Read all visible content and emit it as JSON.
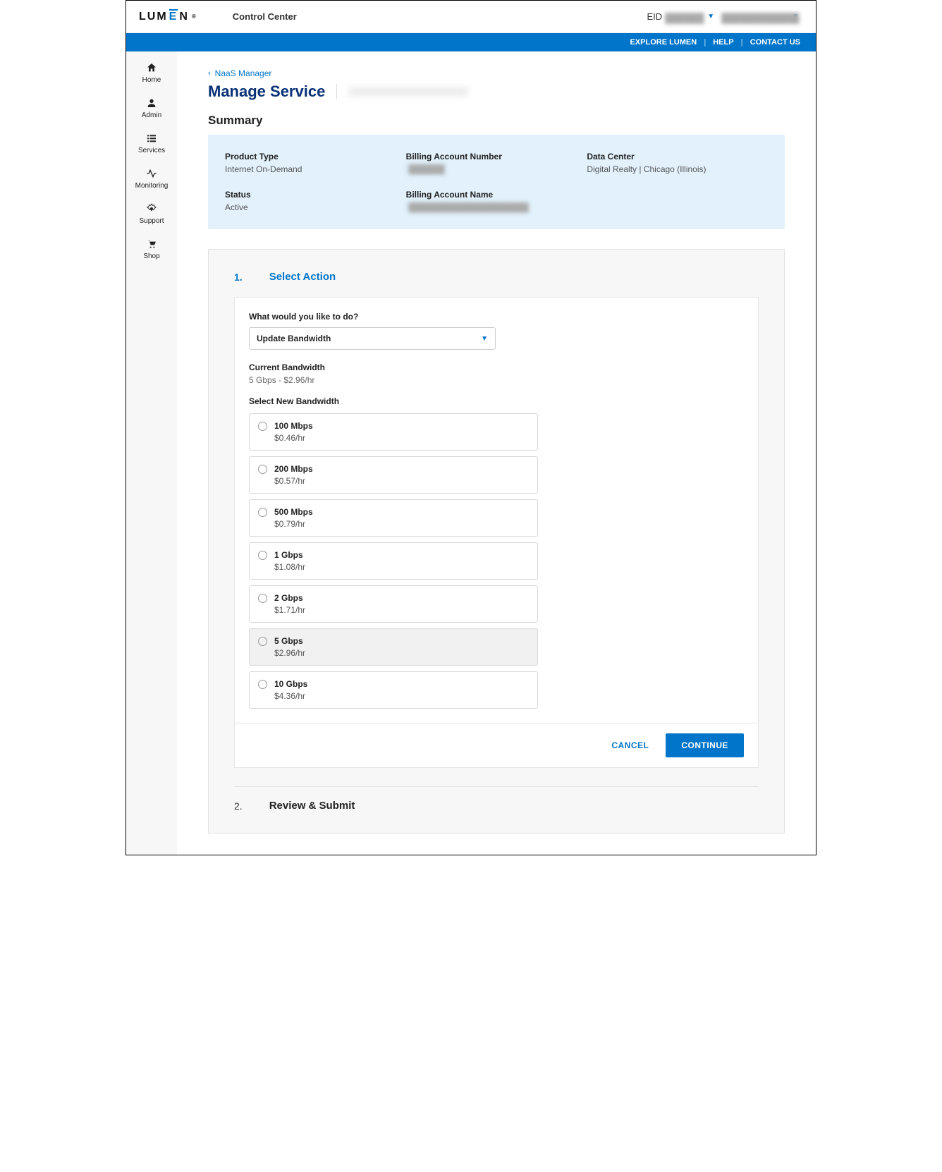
{
  "header": {
    "logo_text": "LUMEN",
    "app_title": "Control Center",
    "eid_label": "EID",
    "eid_value": "██████",
    "account_value": "████████████"
  },
  "bluebar": {
    "explore": "EXPLORE LUMEN",
    "help": "HELP",
    "contact": "CONTACT US"
  },
  "sidebar": {
    "items": [
      {
        "label": "Home",
        "icon": "home-icon"
      },
      {
        "label": "Admin",
        "icon": "user-icon"
      },
      {
        "label": "Services",
        "icon": "list-icon"
      },
      {
        "label": "Monitoring",
        "icon": "activity-icon"
      },
      {
        "label": "Support",
        "icon": "support-icon"
      },
      {
        "label": "Shop",
        "icon": "cart-icon"
      }
    ]
  },
  "breadcrumb": {
    "back_label": "NaaS Manager"
  },
  "page": {
    "title": "Manage Service",
    "section_summary": "Summary"
  },
  "summary": {
    "product_type_label": "Product Type",
    "product_type_value": "Internet On-Demand",
    "billing_number_label": "Billing Account Number",
    "billing_number_value": "██████",
    "data_center_label": "Data Center",
    "data_center_value": "Digital Realty | Chicago (Illinois)",
    "status_label": "Status",
    "status_value": "Active",
    "billing_name_label": "Billing Account Name",
    "billing_name_value": "████████████████████"
  },
  "wizard": {
    "step1_num": "1.",
    "step1_title": "Select Action",
    "action_question": "What would you like to do?",
    "action_selected": "Update Bandwidth",
    "current_bw_label": "Current Bandwidth",
    "current_bw_value": "5 Gbps - $2.96/hr",
    "new_bw_label": "Select New Bandwidth",
    "options": [
      {
        "label": "100 Mbps",
        "price": "$0.46/hr",
        "current": false
      },
      {
        "label": "200 Mbps",
        "price": "$0.57/hr",
        "current": false
      },
      {
        "label": "500 Mbps",
        "price": "$0.79/hr",
        "current": false
      },
      {
        "label": "1 Gbps",
        "price": "$1.08/hr",
        "current": false
      },
      {
        "label": "2 Gbps",
        "price": "$1.71/hr",
        "current": false
      },
      {
        "label": "5 Gbps",
        "price": "$2.96/hr",
        "current": true
      },
      {
        "label": "10 Gbps",
        "price": "$4.36/hr",
        "current": false
      }
    ],
    "cancel_label": "CANCEL",
    "continue_label": "CONTINUE",
    "step2_num": "2.",
    "step2_title": "Review & Submit"
  }
}
